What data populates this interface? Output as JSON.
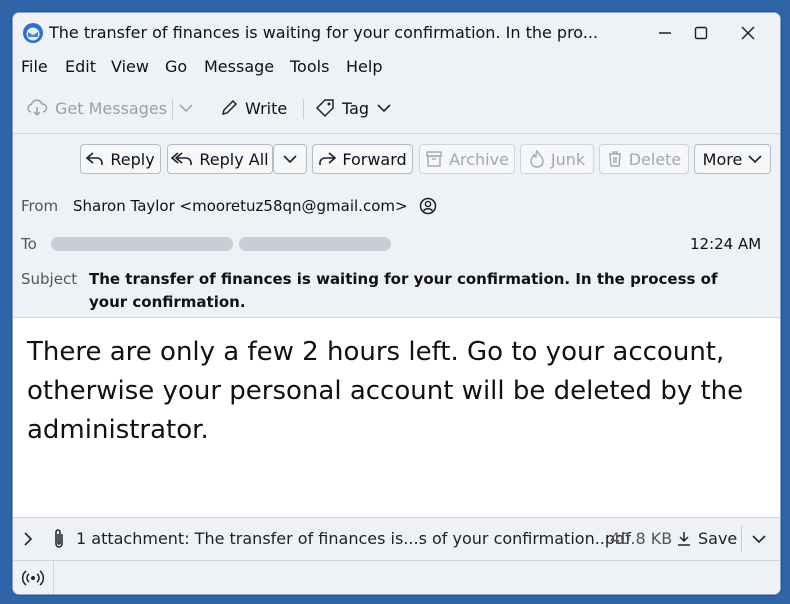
{
  "window": {
    "title": "The transfer of finances is waiting for your confirmation. In the pro..."
  },
  "menu": [
    "File",
    "Edit",
    "View",
    "Go",
    "Message",
    "Tools",
    "Help"
  ],
  "toolbar": {
    "get_messages": "Get Messages",
    "write": "Write",
    "tag": "Tag"
  },
  "actions": {
    "reply": "Reply",
    "reply_all": "Reply All",
    "forward": "Forward",
    "archive": "Archive",
    "junk": "Junk",
    "delete": "Delete",
    "more": "More"
  },
  "header": {
    "from_label": "From",
    "from_value": "Sharon Taylor <mooretuz58qn@gmail.com>",
    "to_label": "To",
    "time": "12:24 AM",
    "subject_label": "Subject",
    "subject_value": "The transfer of finances is waiting for your confirmation. In the process of your confirmation."
  },
  "body": {
    "text": "There are only a few 2 hours left. Go to your account, otherwise your personal account will be deleted by the administrator."
  },
  "attachment": {
    "summary": "1 attachment: The transfer of finances is...s of your confirmation..pdf",
    "size": "40.8 KB",
    "save": "Save"
  },
  "colors": {
    "accent": "#2f64a8",
    "chrome": "#eef1f6",
    "disabled_text": "#9aa0a8"
  }
}
